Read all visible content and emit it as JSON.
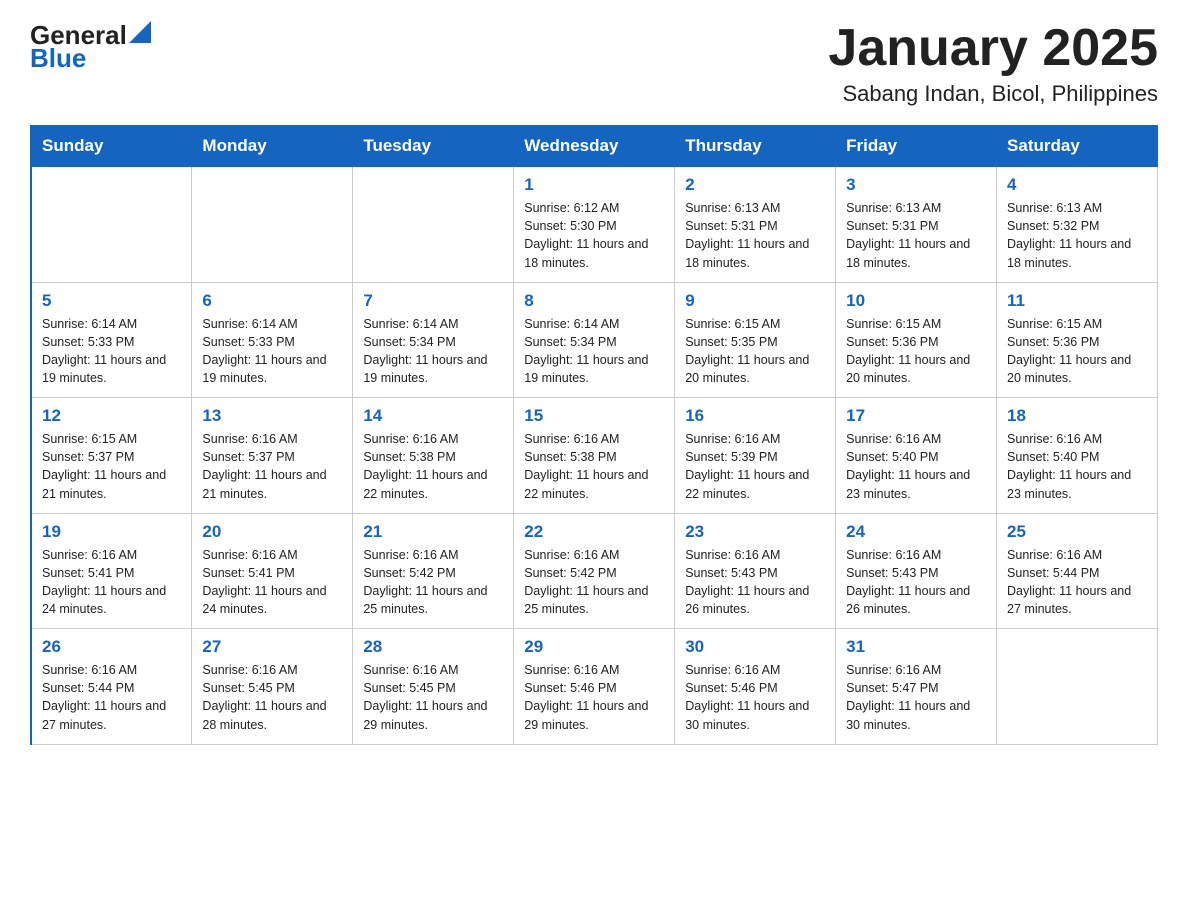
{
  "header": {
    "logo": {
      "text_general": "General",
      "text_blue": "Blue"
    },
    "month": "January 2025",
    "location": "Sabang Indan, Bicol, Philippines"
  },
  "days_of_week": [
    "Sunday",
    "Monday",
    "Tuesday",
    "Wednesday",
    "Thursday",
    "Friday",
    "Saturday"
  ],
  "weeks": [
    [
      {
        "day": "",
        "info": ""
      },
      {
        "day": "",
        "info": ""
      },
      {
        "day": "",
        "info": ""
      },
      {
        "day": "1",
        "info": "Sunrise: 6:12 AM\nSunset: 5:30 PM\nDaylight: 11 hours\nand 18 minutes."
      },
      {
        "day": "2",
        "info": "Sunrise: 6:13 AM\nSunset: 5:31 PM\nDaylight: 11 hours\nand 18 minutes."
      },
      {
        "day": "3",
        "info": "Sunrise: 6:13 AM\nSunset: 5:31 PM\nDaylight: 11 hours\nand 18 minutes."
      },
      {
        "day": "4",
        "info": "Sunrise: 6:13 AM\nSunset: 5:32 PM\nDaylight: 11 hours\nand 18 minutes."
      }
    ],
    [
      {
        "day": "5",
        "info": "Sunrise: 6:14 AM\nSunset: 5:33 PM\nDaylight: 11 hours\nand 19 minutes."
      },
      {
        "day": "6",
        "info": "Sunrise: 6:14 AM\nSunset: 5:33 PM\nDaylight: 11 hours\nand 19 minutes."
      },
      {
        "day": "7",
        "info": "Sunrise: 6:14 AM\nSunset: 5:34 PM\nDaylight: 11 hours\nand 19 minutes."
      },
      {
        "day": "8",
        "info": "Sunrise: 6:14 AM\nSunset: 5:34 PM\nDaylight: 11 hours\nand 19 minutes."
      },
      {
        "day": "9",
        "info": "Sunrise: 6:15 AM\nSunset: 5:35 PM\nDaylight: 11 hours\nand 20 minutes."
      },
      {
        "day": "10",
        "info": "Sunrise: 6:15 AM\nSunset: 5:36 PM\nDaylight: 11 hours\nand 20 minutes."
      },
      {
        "day": "11",
        "info": "Sunrise: 6:15 AM\nSunset: 5:36 PM\nDaylight: 11 hours\nand 20 minutes."
      }
    ],
    [
      {
        "day": "12",
        "info": "Sunrise: 6:15 AM\nSunset: 5:37 PM\nDaylight: 11 hours\nand 21 minutes."
      },
      {
        "day": "13",
        "info": "Sunrise: 6:16 AM\nSunset: 5:37 PM\nDaylight: 11 hours\nand 21 minutes."
      },
      {
        "day": "14",
        "info": "Sunrise: 6:16 AM\nSunset: 5:38 PM\nDaylight: 11 hours\nand 22 minutes."
      },
      {
        "day": "15",
        "info": "Sunrise: 6:16 AM\nSunset: 5:38 PM\nDaylight: 11 hours\nand 22 minutes."
      },
      {
        "day": "16",
        "info": "Sunrise: 6:16 AM\nSunset: 5:39 PM\nDaylight: 11 hours\nand 22 minutes."
      },
      {
        "day": "17",
        "info": "Sunrise: 6:16 AM\nSunset: 5:40 PM\nDaylight: 11 hours\nand 23 minutes."
      },
      {
        "day": "18",
        "info": "Sunrise: 6:16 AM\nSunset: 5:40 PM\nDaylight: 11 hours\nand 23 minutes."
      }
    ],
    [
      {
        "day": "19",
        "info": "Sunrise: 6:16 AM\nSunset: 5:41 PM\nDaylight: 11 hours\nand 24 minutes."
      },
      {
        "day": "20",
        "info": "Sunrise: 6:16 AM\nSunset: 5:41 PM\nDaylight: 11 hours\nand 24 minutes."
      },
      {
        "day": "21",
        "info": "Sunrise: 6:16 AM\nSunset: 5:42 PM\nDaylight: 11 hours\nand 25 minutes."
      },
      {
        "day": "22",
        "info": "Sunrise: 6:16 AM\nSunset: 5:42 PM\nDaylight: 11 hours\nand 25 minutes."
      },
      {
        "day": "23",
        "info": "Sunrise: 6:16 AM\nSunset: 5:43 PM\nDaylight: 11 hours\nand 26 minutes."
      },
      {
        "day": "24",
        "info": "Sunrise: 6:16 AM\nSunset: 5:43 PM\nDaylight: 11 hours\nand 26 minutes."
      },
      {
        "day": "25",
        "info": "Sunrise: 6:16 AM\nSunset: 5:44 PM\nDaylight: 11 hours\nand 27 minutes."
      }
    ],
    [
      {
        "day": "26",
        "info": "Sunrise: 6:16 AM\nSunset: 5:44 PM\nDaylight: 11 hours\nand 27 minutes."
      },
      {
        "day": "27",
        "info": "Sunrise: 6:16 AM\nSunset: 5:45 PM\nDaylight: 11 hours\nand 28 minutes."
      },
      {
        "day": "28",
        "info": "Sunrise: 6:16 AM\nSunset: 5:45 PM\nDaylight: 11 hours\nand 29 minutes."
      },
      {
        "day": "29",
        "info": "Sunrise: 6:16 AM\nSunset: 5:46 PM\nDaylight: 11 hours\nand 29 minutes."
      },
      {
        "day": "30",
        "info": "Sunrise: 6:16 AM\nSunset: 5:46 PM\nDaylight: 11 hours\nand 30 minutes."
      },
      {
        "day": "31",
        "info": "Sunrise: 6:16 AM\nSunset: 5:47 PM\nDaylight: 11 hours\nand 30 minutes."
      },
      {
        "day": "",
        "info": ""
      }
    ]
  ]
}
